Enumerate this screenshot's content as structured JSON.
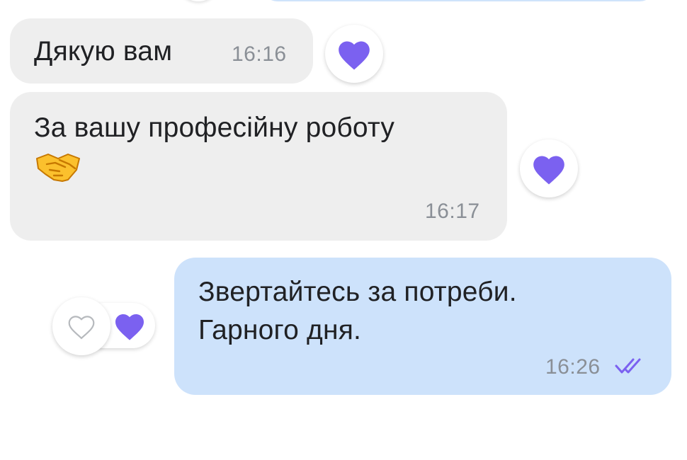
{
  "colors": {
    "incoming_bubble": "#eeeeee",
    "outgoing_bubble": "#cde2fb",
    "heart": "#7b61f0",
    "time_text": "#8a8f96"
  },
  "messages": [
    {
      "direction": "incoming",
      "text": "Дякую вам",
      "time": "16:16",
      "reaction": "heart-icon"
    },
    {
      "direction": "incoming",
      "text": "За вашу професійну роботу",
      "emoji": "handshake-emoji",
      "time": "16:17",
      "reaction": "heart-icon"
    },
    {
      "direction": "outgoing",
      "lines": [
        "Звертайтесь за потреби.",
        "Гарного дня."
      ],
      "time": "16:26",
      "status": "read",
      "status_icon": "double-check-icon",
      "reaction_picker": [
        "heart-outline-icon",
        "heart-icon"
      ]
    }
  ]
}
